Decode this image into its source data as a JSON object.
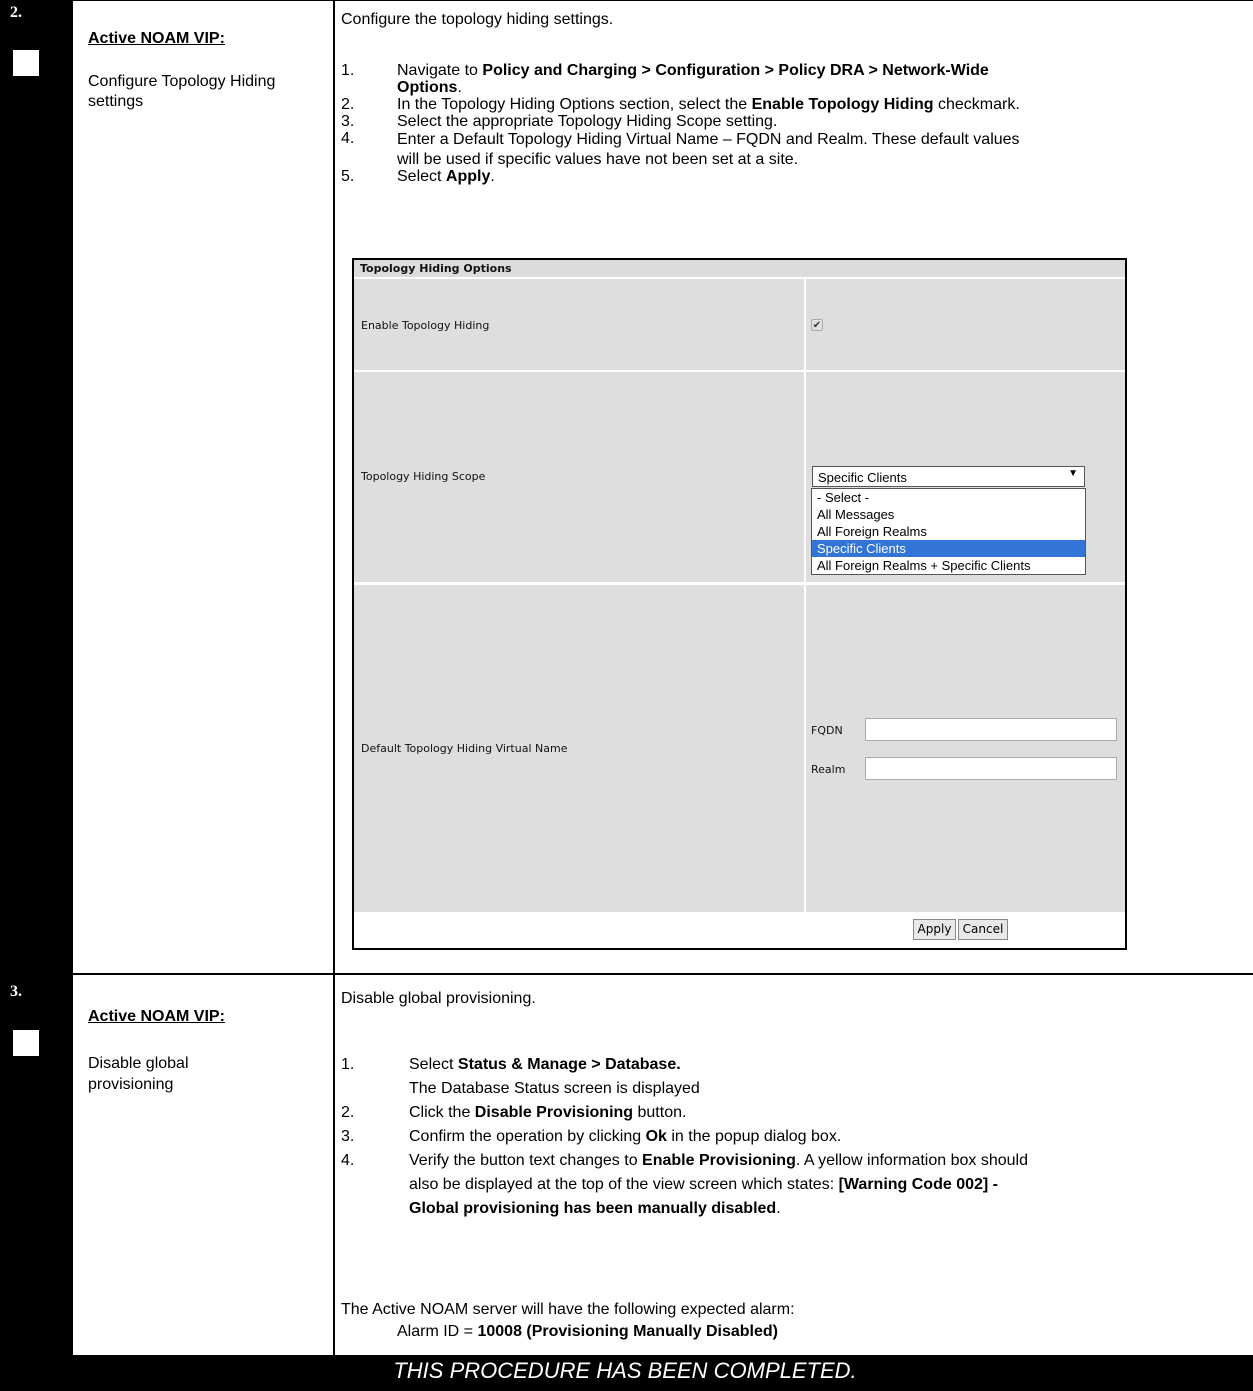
{
  "step2": {
    "number": "2.",
    "title": "Active NOAM VIP:",
    "description": "Configure Topology Hiding settings",
    "intro": "Configure the topology hiding settings.",
    "items": [
      {
        "n": "1.",
        "pre": "Navigate to ",
        "b1": "Policy and Charging > Configuration > Policy DRA > Network-Wide",
        "b2": "Options",
        "post": "."
      },
      {
        "n": "2.",
        "pre": "In the Topology Hiding Options section, select the ",
        "bold": "Enable Topology Hiding",
        "post": " checkmark."
      },
      {
        "n": "3.",
        "text": "Select the appropriate Topology Hiding Scope setting."
      },
      {
        "n": "4.",
        "line1": "Enter a Default Topology Hiding Virtual Name – FQDN and Realm. These default values",
        "line2": "will be used if specific values have not been set at a site."
      },
      {
        "n": "5.",
        "pre": "Select ",
        "bold": "Apply",
        "post": "."
      }
    ],
    "screenshot": {
      "header": "Topology Hiding Options",
      "enable_label": "Enable Topology Hiding",
      "enable_checked": true,
      "scope_label": "Topology Hiding Scope",
      "scope_selected": "Specific Clients",
      "scope_options": [
        "- Select -",
        "All Messages",
        "All Foreign Realms",
        "Specific Clients",
        "All Foreign Realms + Specific Clients"
      ],
      "virtual_name_label": "Default Topology Hiding Virtual Name",
      "fqdn_label": "FQDN",
      "fqdn_value": "",
      "realm_label": "Realm",
      "realm_value": "",
      "apply": "Apply",
      "cancel": "Cancel"
    }
  },
  "step3": {
    "number": "3.",
    "title": "Active NOAM VIP:",
    "desc_line1": "Disable global",
    "desc_line2": "provisioning",
    "intro": "Disable global provisioning.",
    "i1_n": "1.",
    "i1_pre": "Select ",
    "i1_bold": "Status & Manage > Database.",
    "i1_sub": "The Database Status screen is displayed",
    "i2_n": "2.",
    "i2_pre": "Click the ",
    "i2_bold": "Disable Provisioning",
    "i2_post": " button.",
    "i3_n": "3.",
    "i3_pre": "Confirm the operation by clicking ",
    "i3_bold": "Ok",
    "i3_post": " in the popup dialog box.",
    "i4_n": "4.",
    "i4_pre": "Verify the button text changes to ",
    "i4_bold": "Enable Provisioning",
    "i4_post": ". A yellow information box should",
    "i4_line2_pre": "also be displayed at the top of the view screen which states: ",
    "i4_line2_bold": "[Warning Code 002] -",
    "i4_line3_bold": "Global provisioning has been manually disabled",
    "i4_line3_post": ".",
    "alarm_intro": "The Active NOAM server will have the following expected alarm:",
    "alarm_pre": "Alarm ID = ",
    "alarm_bold": "10008 (Provisioning Manually Disabled)"
  },
  "footer": "THIS PROCEDURE HAS BEEN COMPLETED."
}
